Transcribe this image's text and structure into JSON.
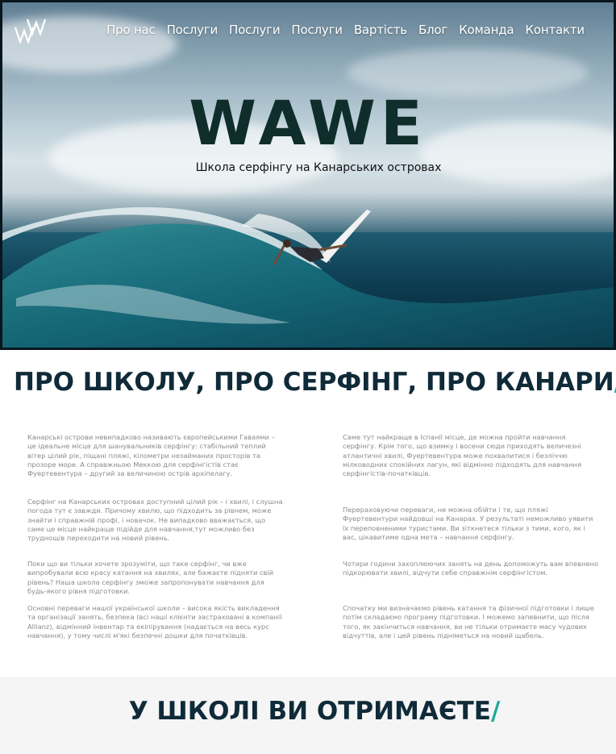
{
  "header": {
    "logo_icon": "wave-w-logo-icon",
    "nav": [
      {
        "label": "Про нас"
      },
      {
        "label": "Послуги"
      },
      {
        "label": "Послуги"
      },
      {
        "label": "Послуги"
      },
      {
        "label": "Вартість"
      },
      {
        "label": "Блог"
      },
      {
        "label": "Команда"
      },
      {
        "label": "Контакти"
      }
    ]
  },
  "hero": {
    "brand": "WAWE",
    "tagline": "Школа серфінгу на Канарських островах"
  },
  "about": {
    "title": "ПРО ШКОЛУ, ПРО СЕРФІНГ, ПРО КАНАРИ",
    "slash": "/",
    "left_paragraphs": [
      "Канарські острови невипадково називають європейськими Гаваями – це ідеальне місце для шанувальників серфінгу: стабільний теплий вітер цілий рік, піщані пляжі, кілометри незайманих просторів та прозоре море. А справжньою Меккою для серфінгістів стає Фуертевентура – другий за величиною острів архіпелагу.",
      "Серфінг на Канарських островах доступний цілий рік – і хвилі, і слушна погода тут є завжди. Причому хвилю, що підходить за рівнем, може знайти і справжній профі, і новачок. Не випадково вважається, що саме це місце найкраще підійде для навчання,тут можливо без труднощів переходити на новий рівень.",
      "Поки що ви тільки хочете зрозуміти, що таке серфінг, чи вже випробували всю красу катання на хвилях, але бажаєте підняти свій рівень? Наша школа серфінгу зможе запропонувати навчання для будь-якого рівня підготовки.",
      "Основні переваги нашої української школи – висока якість викладення та організації занять, безпека (всі наші клієнти застраховані в компанії Allianz), відмінний інвентар та екіпірування (надається на весь курс навчання), у тому числі м'які безпечні дошки для початківців."
    ],
    "right_paragraphs": [
      "Саме тут найкраще в Іспанії місце, де можна пройти навчання серфінгу. Крім того, що взимку і восени сюди приходять величезні атлантичні хвилі, Фуертевентура може похвалитися і безліччю мілководних спокійних лагун, які відмінно підходять для навчання серфінгістів-початківців.",
      "Перераховуючи переваги, не можна обійти і те, що пляжі Фуертевентури найдовші на Канарах. У результаті неможливо уявити їх переповненими туристами. Ви зіткнетеся тільки з тими, кого, як і вас, цікавитиме одна мета – навчання серфінгу.",
      "Чотири години захоплюючих занять на день допоможуть вам впевнено підкорювати хвилі, відчути себе справжнім серфінгістом.",
      "Спочатку ми визначаємо рівень катання та фізичної підготовки і лише потім складаємо програму підготовки. І можемо запевнити, що після того, як закінчиться навчання, ви не тільки отримаєте масу чудових відчуттів, але і цей рівень підніметься на новий щабель."
    ]
  },
  "benefits": {
    "title": "У ШКОЛІ ВИ ОТРИМАЄТЕ",
    "slash": "/"
  },
  "colors": {
    "accent": "#1ba89a",
    "heading": "#0f2a38",
    "brand": "#0f2e2b",
    "body_text": "#8a8a8a"
  }
}
